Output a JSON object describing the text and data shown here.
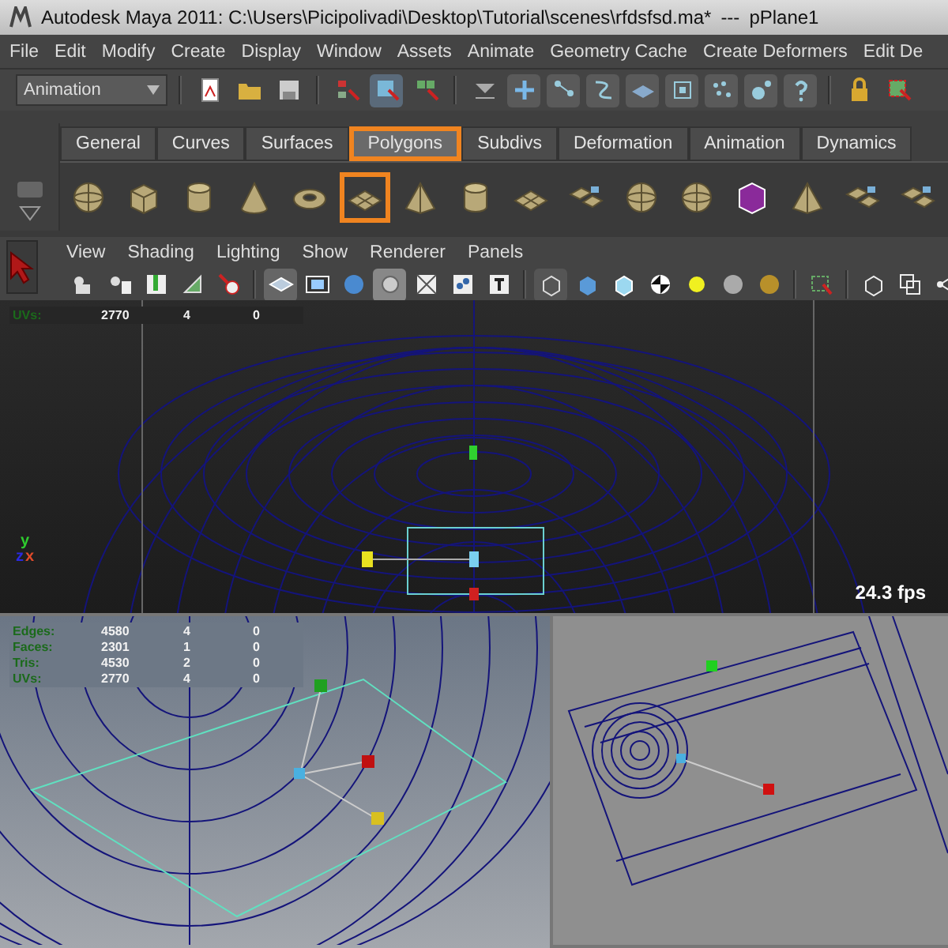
{
  "window": {
    "title": "Autodesk Maya 2011: C:\\Users\\Picipolivadi\\Desktop\\Tutorial\\scenes\\rfdsfsd.ma*",
    "separator": "---",
    "object": "pPlane1"
  },
  "menu_bar": [
    "File",
    "Edit",
    "Modify",
    "Create",
    "Display",
    "Window",
    "Assets",
    "Animate",
    "Geometry Cache",
    "Create Deformers",
    "Edit De"
  ],
  "status_line": {
    "mode": "Animation"
  },
  "shelf": {
    "tabs": [
      {
        "label": "General",
        "selected": false,
        "highlighted": false
      },
      {
        "label": "Curves",
        "selected": false,
        "highlighted": false
      },
      {
        "label": "Surfaces",
        "selected": false,
        "highlighted": false
      },
      {
        "label": "Polygons",
        "selected": true,
        "highlighted": true
      },
      {
        "label": "Subdivs",
        "selected": false,
        "highlighted": false
      },
      {
        "label": "Deformation",
        "selected": false,
        "highlighted": false
      },
      {
        "label": "Animation",
        "selected": false,
        "highlighted": false
      },
      {
        "label": "Dynamics",
        "selected": false,
        "highlighted": false
      }
    ],
    "tools": [
      {
        "kind": "sphere",
        "highlighted": false
      },
      {
        "kind": "cube",
        "highlighted": false
      },
      {
        "kind": "cylinder",
        "highlighted": false
      },
      {
        "kind": "cone",
        "highlighted": false
      },
      {
        "kind": "torus",
        "highlighted": false
      },
      {
        "kind": "plane",
        "highlighted": true
      },
      {
        "kind": "pyramid",
        "highlighted": false
      },
      {
        "kind": "cylinder",
        "highlighted": false
      },
      {
        "kind": "plane",
        "highlighted": false
      },
      {
        "kind": "tiles",
        "highlighted": false
      },
      {
        "kind": "sphere",
        "highlighted": false
      },
      {
        "kind": "sphere",
        "highlighted": false
      },
      {
        "kind": "box",
        "highlighted": false
      },
      {
        "kind": "pyramid",
        "highlighted": false
      },
      {
        "kind": "tiles",
        "highlighted": false
      },
      {
        "kind": "tiles",
        "highlighted": false
      }
    ]
  },
  "panel_menu": [
    "View",
    "Shading",
    "Lighting",
    "Show",
    "Renderer",
    "Panels"
  ],
  "top_view": {
    "hud": [
      {
        "label": "UVs:",
        "values": [
          "2770",
          "4",
          "0"
        ]
      }
    ],
    "axes": [
      "y",
      "z",
      "x"
    ],
    "fps": "24.3 fps"
  },
  "bottom_left_view": {
    "hud": [
      {
        "label": "Edges:",
        "values": [
          "4580",
          "4",
          "0"
        ]
      },
      {
        "label": "Faces:",
        "values": [
          "2301",
          "1",
          "0"
        ]
      },
      {
        "label": "Tris:",
        "values": [
          "4530",
          "2",
          "0"
        ]
      },
      {
        "label": "UVs:",
        "values": [
          "2770",
          "4",
          "0"
        ]
      }
    ]
  }
}
